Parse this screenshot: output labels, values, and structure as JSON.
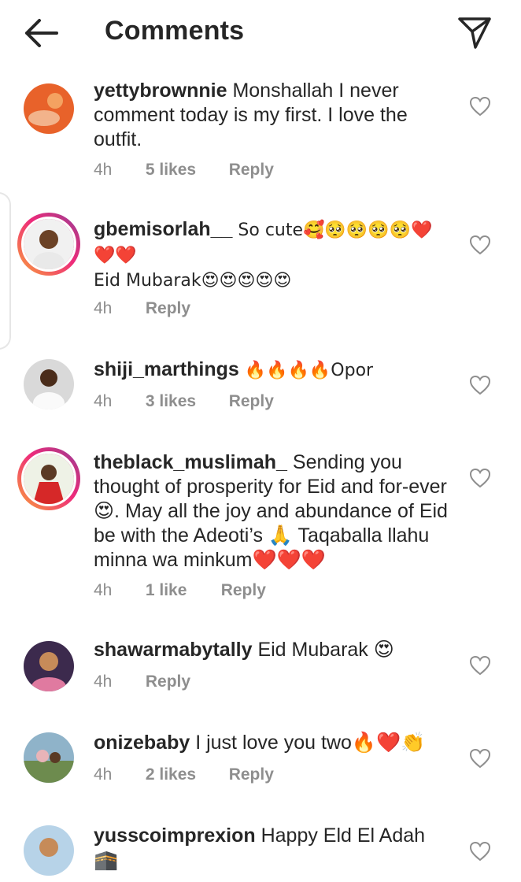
{
  "header": {
    "title": "Comments",
    "back_icon": "arrow-left-icon",
    "share_icon": "paper-plane-icon"
  },
  "colors": {
    "text": "#262626",
    "meta": "#8e8e8e",
    "story_ring_start": "#f9a13a",
    "story_ring_end": "#c13584"
  },
  "comments": [
    {
      "username": "yettybrownnie",
      "text": "Monshallah I never comment today is my first. I love the outfit.",
      "time": "4h",
      "likes": "5 likes",
      "reply": "Reply"
    },
    {
      "username": "gbemisorlah__",
      "text": "So cute🥰🥺🥺🥺🥺❤️❤️❤️",
      "text2": "Eid Mubarak😍😍😍😍😍",
      "time": "4h",
      "likes": "",
      "reply": "Reply"
    },
    {
      "username": "shiji_marthings",
      "text": "🔥🔥🔥🔥Opor",
      "time": "4h",
      "likes": "3 likes",
      "reply": "Reply"
    },
    {
      "username": "theblack_muslimah_",
      "text": "Sending you thought of prosperity for Eid and for-ever 😍. May all the joy and abundance of Eid be with the Adeoti’s 🙏 Taqaballa llahu minna wa minkum❤️❤️❤️",
      "time": "4h",
      "likes": "1 like",
      "reply": "Reply"
    },
    {
      "username": "shawarmabytally",
      "text": "Eid Mubarak 😍",
      "time": "4h",
      "likes": "",
      "reply": "Reply"
    },
    {
      "username": "onizebaby",
      "text": "I just love you two🔥❤️👏",
      "time": "4h",
      "likes": "2 likes",
      "reply": "Reply"
    },
    {
      "username": "yusscoimprexion",
      "text": "Happy Eld El Adah 🕋",
      "time": "",
      "likes": "",
      "reply": ""
    }
  ]
}
